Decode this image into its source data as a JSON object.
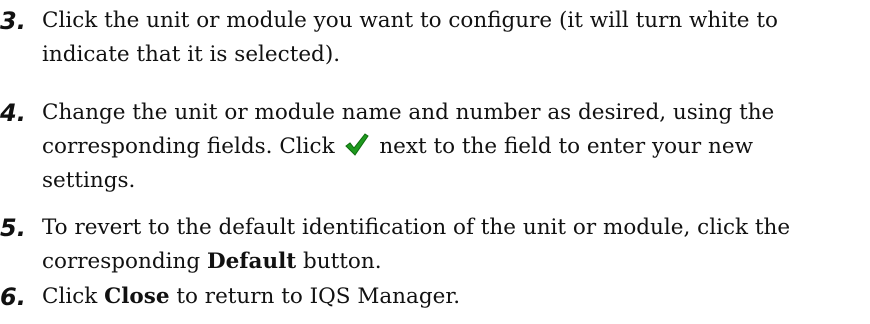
{
  "steps": [
    {
      "number": "3.",
      "line1": "Click the unit or module you want to configure (it will turn white to",
      "line2": "indicate that it is selected)."
    },
    {
      "number": "4.",
      "line1": "Change the unit or module name and number as desired, using the",
      "line2_before": "corresponding fields. Click",
      "line2_after": "next to the field to enter your new",
      "line3": "settings.",
      "icon": "checkmark-icon",
      "icon_color": "#1e9a1e"
    },
    {
      "number": "5.",
      "line1": "To revert to the default identification of the unit or module, click the",
      "line2_before": "corresponding",
      "line2_bold": "Default",
      "line2_after": "button."
    },
    {
      "number": "6.",
      "text_before": "Click",
      "text_bold": "Close",
      "text_after": "to return to IQS Manager."
    }
  ]
}
